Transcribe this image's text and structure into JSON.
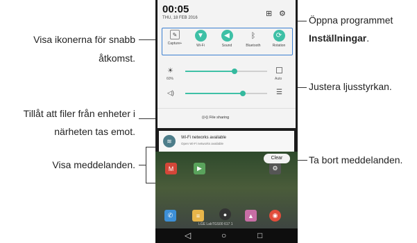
{
  "callouts": {
    "quick_icons": [
      "Visa ikonerna för snabb",
      "åtkomst."
    ],
    "file_sharing": [
      "Tillåt att filer från enheter i",
      "närheten tas emot."
    ],
    "notifications": "Visa meddelanden.",
    "settings_prefix": "Öppna programmet",
    "settings_bold": "Inställningar",
    "settings_suffix": ".",
    "brightness": "Justera ljusstyrkan.",
    "clear": "Ta bort meddelanden."
  },
  "status": {
    "time": "00:05",
    "date": "THU, 18 FEB 2016"
  },
  "quick_settings": [
    {
      "label": "Capture+",
      "icon": "capture-icon",
      "color": "#ffffff"
    },
    {
      "label": "Wi-Fi",
      "icon": "wifi-icon",
      "color": "#3ec0a6"
    },
    {
      "label": "Sound",
      "icon": "sound-icon",
      "color": "#3ec0a6"
    },
    {
      "label": "Bluetooth",
      "icon": "bluetooth-icon",
      "color": "#ffffff"
    },
    {
      "label": "Rotation",
      "icon": "rotation-icon",
      "color": "#3ec0a6"
    }
  ],
  "brightness": {
    "percent_label": "60%",
    "auto_label": "Auto",
    "level": 0.6
  },
  "volume": {
    "level": 0.7
  },
  "file_sharing_label": "File sharing",
  "notification": {
    "title": "Wi-Fi networks available",
    "subtitle": "Open Wi-Fi networks available"
  },
  "clear_label": "Clear",
  "carrier": "LGE LabTGS00 617 1",
  "accent_color": "#3ec0a6"
}
